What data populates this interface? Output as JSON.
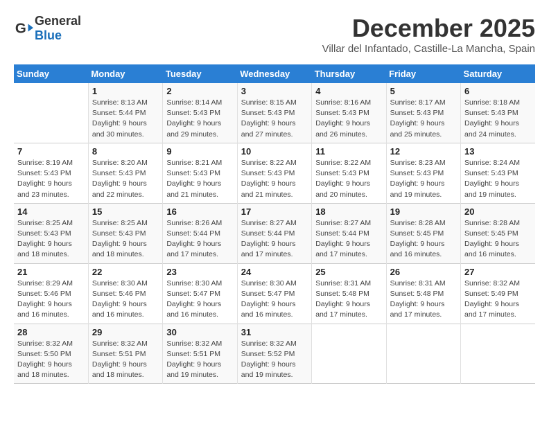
{
  "logo": {
    "general": "General",
    "blue": "Blue"
  },
  "title": "December 2025",
  "subtitle": "Villar del Infantado, Castille-La Mancha, Spain",
  "days_of_week": [
    "Sunday",
    "Monday",
    "Tuesday",
    "Wednesday",
    "Thursday",
    "Friday",
    "Saturday"
  ],
  "weeks": [
    [
      {
        "num": "",
        "detail": ""
      },
      {
        "num": "1",
        "detail": "Sunrise: 8:13 AM\nSunset: 5:44 PM\nDaylight: 9 hours\nand 30 minutes."
      },
      {
        "num": "2",
        "detail": "Sunrise: 8:14 AM\nSunset: 5:43 PM\nDaylight: 9 hours\nand 29 minutes."
      },
      {
        "num": "3",
        "detail": "Sunrise: 8:15 AM\nSunset: 5:43 PM\nDaylight: 9 hours\nand 27 minutes."
      },
      {
        "num": "4",
        "detail": "Sunrise: 8:16 AM\nSunset: 5:43 PM\nDaylight: 9 hours\nand 26 minutes."
      },
      {
        "num": "5",
        "detail": "Sunrise: 8:17 AM\nSunset: 5:43 PM\nDaylight: 9 hours\nand 25 minutes."
      },
      {
        "num": "6",
        "detail": "Sunrise: 8:18 AM\nSunset: 5:43 PM\nDaylight: 9 hours\nand 24 minutes."
      }
    ],
    [
      {
        "num": "7",
        "detail": "Sunrise: 8:19 AM\nSunset: 5:43 PM\nDaylight: 9 hours\nand 23 minutes."
      },
      {
        "num": "8",
        "detail": "Sunrise: 8:20 AM\nSunset: 5:43 PM\nDaylight: 9 hours\nand 22 minutes."
      },
      {
        "num": "9",
        "detail": "Sunrise: 8:21 AM\nSunset: 5:43 PM\nDaylight: 9 hours\nand 21 minutes."
      },
      {
        "num": "10",
        "detail": "Sunrise: 8:22 AM\nSunset: 5:43 PM\nDaylight: 9 hours\nand 21 minutes."
      },
      {
        "num": "11",
        "detail": "Sunrise: 8:22 AM\nSunset: 5:43 PM\nDaylight: 9 hours\nand 20 minutes."
      },
      {
        "num": "12",
        "detail": "Sunrise: 8:23 AM\nSunset: 5:43 PM\nDaylight: 9 hours\nand 19 minutes."
      },
      {
        "num": "13",
        "detail": "Sunrise: 8:24 AM\nSunset: 5:43 PM\nDaylight: 9 hours\nand 19 minutes."
      }
    ],
    [
      {
        "num": "14",
        "detail": "Sunrise: 8:25 AM\nSunset: 5:43 PM\nDaylight: 9 hours\nand 18 minutes."
      },
      {
        "num": "15",
        "detail": "Sunrise: 8:25 AM\nSunset: 5:43 PM\nDaylight: 9 hours\nand 18 minutes."
      },
      {
        "num": "16",
        "detail": "Sunrise: 8:26 AM\nSunset: 5:44 PM\nDaylight: 9 hours\nand 17 minutes."
      },
      {
        "num": "17",
        "detail": "Sunrise: 8:27 AM\nSunset: 5:44 PM\nDaylight: 9 hours\nand 17 minutes."
      },
      {
        "num": "18",
        "detail": "Sunrise: 8:27 AM\nSunset: 5:44 PM\nDaylight: 9 hours\nand 17 minutes."
      },
      {
        "num": "19",
        "detail": "Sunrise: 8:28 AM\nSunset: 5:45 PM\nDaylight: 9 hours\nand 16 minutes."
      },
      {
        "num": "20",
        "detail": "Sunrise: 8:28 AM\nSunset: 5:45 PM\nDaylight: 9 hours\nand 16 minutes."
      }
    ],
    [
      {
        "num": "21",
        "detail": "Sunrise: 8:29 AM\nSunset: 5:46 PM\nDaylight: 9 hours\nand 16 minutes."
      },
      {
        "num": "22",
        "detail": "Sunrise: 8:30 AM\nSunset: 5:46 PM\nDaylight: 9 hours\nand 16 minutes."
      },
      {
        "num": "23",
        "detail": "Sunrise: 8:30 AM\nSunset: 5:47 PM\nDaylight: 9 hours\nand 16 minutes."
      },
      {
        "num": "24",
        "detail": "Sunrise: 8:30 AM\nSunset: 5:47 PM\nDaylight: 9 hours\nand 16 minutes."
      },
      {
        "num": "25",
        "detail": "Sunrise: 8:31 AM\nSunset: 5:48 PM\nDaylight: 9 hours\nand 17 minutes."
      },
      {
        "num": "26",
        "detail": "Sunrise: 8:31 AM\nSunset: 5:48 PM\nDaylight: 9 hours\nand 17 minutes."
      },
      {
        "num": "27",
        "detail": "Sunrise: 8:32 AM\nSunset: 5:49 PM\nDaylight: 9 hours\nand 17 minutes."
      }
    ],
    [
      {
        "num": "28",
        "detail": "Sunrise: 8:32 AM\nSunset: 5:50 PM\nDaylight: 9 hours\nand 18 minutes."
      },
      {
        "num": "29",
        "detail": "Sunrise: 8:32 AM\nSunset: 5:51 PM\nDaylight: 9 hours\nand 18 minutes."
      },
      {
        "num": "30",
        "detail": "Sunrise: 8:32 AM\nSunset: 5:51 PM\nDaylight: 9 hours\nand 19 minutes."
      },
      {
        "num": "31",
        "detail": "Sunrise: 8:32 AM\nSunset: 5:52 PM\nDaylight: 9 hours\nand 19 minutes."
      },
      {
        "num": "",
        "detail": ""
      },
      {
        "num": "",
        "detail": ""
      },
      {
        "num": "",
        "detail": ""
      }
    ]
  ]
}
